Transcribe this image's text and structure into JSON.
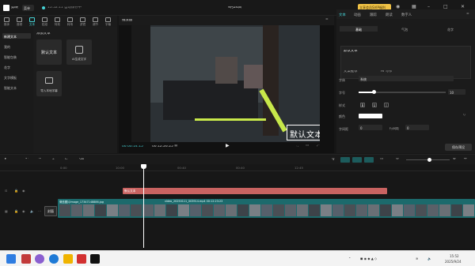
{
  "app": {
    "name": "剪映",
    "menu_label": "菜单",
    "autosave": "15:52:11 自动保存中",
    "project_title": "9月24日",
    "promo_label": "立享会员SVIP福利"
  },
  "tools": [
    {
      "label": "媒体"
    },
    {
      "label": "音频"
    },
    {
      "label": "文本"
    },
    {
      "label": "贴纸"
    },
    {
      "label": "特效"
    },
    {
      "label": "转场"
    },
    {
      "label": "滤镜"
    },
    {
      "label": "调节"
    },
    {
      "label": "字幕"
    }
  ],
  "categories": [
    {
      "label": "新建文本"
    },
    {
      "label": "我的"
    },
    {
      "label": "智能包装"
    },
    {
      "label": "花字"
    },
    {
      "label": "文字模板"
    },
    {
      "label": "智能文本"
    }
  ],
  "assets": {
    "section_title": "添加文本",
    "default_text_big": "默认文本",
    "ai_card_label": "AI生成文字",
    "import_card_label": "导入本地字幕"
  },
  "player": {
    "title": "播放器",
    "current_time": "00:00:14:15",
    "total_time": "00:12:26:25",
    "caption": "默认文本"
  },
  "props": {
    "tabs": [
      "文本",
      "动画",
      "跟踪",
      "朗读",
      "数字人"
    ],
    "subtabs": [
      "基础",
      "气泡",
      "花字"
    ],
    "text_content": "默认文本",
    "action_1": "文案推荐",
    "action_2": "AI 写作",
    "font_label": "字体",
    "font_value": "系统",
    "size_label": "字号",
    "size_value": "10",
    "style_label": "样式",
    "style_buttons": [
      "B",
      "U",
      "I"
    ],
    "color_label": "颜色",
    "spacing_label": "字间距",
    "spacing_value": "0",
    "line_label": "行间距",
    "line_value": "0",
    "preset_label": "保存预设",
    "size_fraction": 0.18
  },
  "timeline": {
    "ruler": [
      "0:00",
      "10:00",
      "00:40",
      "00:40",
      "12:45"
    ],
    "text_clip_label": "默认文本",
    "video_clip_label_1": "微信图片Image_17347148886.jpg",
    "video_clip_label_2": "video_20250111_003914.mp4   00:12:23:23",
    "cover_label": "封面"
  },
  "taskbar": {
    "time": "15:52",
    "date": "2025/9/24"
  },
  "colors": {
    "accent": "#46d3d6",
    "text_clip": "#c96361",
    "video_clip": "#1c6a6c"
  }
}
